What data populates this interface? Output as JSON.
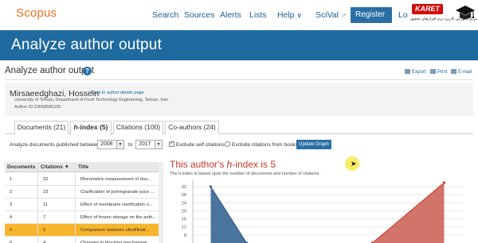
{
  "topnav": {
    "logo": "Scopus",
    "links": [
      "Search",
      "Sources",
      "Alerts",
      "Lists"
    ],
    "help": "Help",
    "scival": "SciVal",
    "register": "Register",
    "register_chevron": "›",
    "login": "Lo",
    "watermark_badge": "KARET",
    "watermark_sub": "مرکز آموزش کاربرد نرم افزارهای تحقیق"
  },
  "band_title": "Analyze author output",
  "subheader": {
    "title": "Analyze author output",
    "help": "?",
    "export": "Export",
    "print": "Print",
    "email": "E-mail"
  },
  "author": {
    "name": "Mirsaeedghazi, Hossein",
    "back_link": "Back to author details page",
    "affiliation": "University of Tehran, Department of Food Technology Engineering, Tehran, Iran",
    "author_id": "Author ID:23668586100"
  },
  "tabs": [
    {
      "label": "Documents (21)",
      "active": false
    },
    {
      "label": "h-index (5)",
      "active": true
    },
    {
      "label": "Citations (100)",
      "active": false
    },
    {
      "label": "Co-authors (24)",
      "active": false
    }
  ],
  "filter": {
    "label": "Analyze documents published between:",
    "from": "2008",
    "to_label": "to",
    "to": "2017",
    "exclude_self": "Exclude self citations",
    "exclude_self_checked": true,
    "exclude_books": "Exclude citations from books",
    "update": "Update Graph"
  },
  "table": {
    "headers": [
      "Documents",
      "Citations ▼",
      "Title"
    ],
    "rows": [
      {
        "doc": "1",
        "cit": "32",
        "title": "Rheometric measurement of dou...",
        "highlight": false
      },
      {
        "doc": "2",
        "cit": "23",
        "title": "Clarification of pomegranate juice ...",
        "highlight": false
      },
      {
        "doc": "3",
        "cit": "11",
        "title": "Effect of membrane clarification o...",
        "highlight": false
      },
      {
        "doc": "4",
        "cit": "7",
        "title": "Effect of frozen storage on the anth...",
        "highlight": false
      },
      {
        "doc": "5",
        "cit": "5",
        "title": "Comparison between ultrafiltrati...",
        "highlight": true
      },
      {
        "doc": "6",
        "cit": "4",
        "title": "Changes in blocking mechanism...",
        "highlight": false
      }
    ]
  },
  "hindex": {
    "title_prefix": "This author's ",
    "title_h": "h",
    "title_suffix": "-index is 5",
    "desc": "The h-index is based upon the number of documents and number of citations."
  },
  "chart_data": {
    "type": "area",
    "y_ticks": [
      32,
      28,
      24,
      20,
      16,
      12,
      8
    ],
    "ylim": [
      4,
      34
    ],
    "series": [
      {
        "color": "#2d5d8c",
        "x": [
          1,
          2
        ],
        "values": [
          32,
          4
        ]
      },
      {
        "color": "#c0392b",
        "x": [
          5.5,
          7.5
        ],
        "values": [
          4,
          34
        ]
      }
    ],
    "xlim": [
      0.5,
      8
    ],
    "grid": true
  }
}
